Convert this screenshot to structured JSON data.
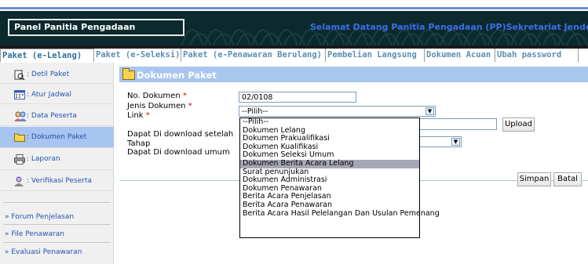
{
  "banner": {
    "panel_title": "Panel Panitia Pengadaan",
    "welcome": "Selamat Datang Panitia Pengadaan (PP)Sekretariat Jendera"
  },
  "tabs": [
    {
      "label": "Paket (e-Lelang)",
      "active": true
    },
    {
      "label": "Paket (e-Seleksi)"
    },
    {
      "label": "Paket (e-Penawaran Berulang)"
    },
    {
      "label": "Pembelian Langsung"
    },
    {
      "label": "Dokumen Acuan"
    },
    {
      "label": "Ubah password"
    }
  ],
  "sidebar": {
    "items": [
      {
        "label": ": Detil Paket",
        "icon": "print-preview-icon"
      },
      {
        "label": ": Atur Jadwal",
        "icon": "calendar-icon"
      },
      {
        "label": ": Data Peserta",
        "icon": "users-icon"
      },
      {
        "label": ": Dokumen Paket",
        "icon": "folder-icon"
      },
      {
        "label": ": Laporan",
        "icon": "printer-icon"
      },
      {
        "label": ": Verifikasi Peserta",
        "icon": "user-check-icon"
      }
    ],
    "links": [
      "Forum Penjelasan",
      "File Penawaran",
      "Evaluasi Penawaran"
    ]
  },
  "main": {
    "heading": "Dokumen Paket",
    "labels": {
      "no_dokumen": "No. Dokumen",
      "jenis_dokumen": "Jenis Dokumen",
      "link": "Link",
      "download_setelah": "Dapat Di download setelah",
      "tahap": "Tahap",
      "download_umum": "Dapat Di download umum"
    },
    "required_mark": "*",
    "no_dokumen_value": "02/0108",
    "jenis_selected": "--Pilih--",
    "upload_label": "Upload",
    "simpan_label": "Simpan",
    "batal_label": "Batal",
    "dropdown_options": [
      "--Pilih--",
      "Dokumen Lelang",
      "Dokumen Prakualifikasi",
      "Dokumen Kualifikasi",
      "Dokumen Seleksi Umum",
      "Dokumen Berita Acara Lelang",
      "Surat penunjukan",
      "Dokumen Administrasi",
      "Dokumen Penawaran",
      "Berita Acara Penjelasan",
      "Berita Acara Penawaran",
      "Berita Acara Hasil Pelelangan Dan Usulan Pemenang"
    ],
    "highlighted_option": "Dokumen Berita Acara Lelang"
  },
  "colors": {
    "banner_bg": "#0c2a2e",
    "welcome_text": "#3d6ee8",
    "heading_bar": "#a9c6ee",
    "sidebar_active": "#a8c4f0",
    "link_blue": "#2255aa"
  }
}
